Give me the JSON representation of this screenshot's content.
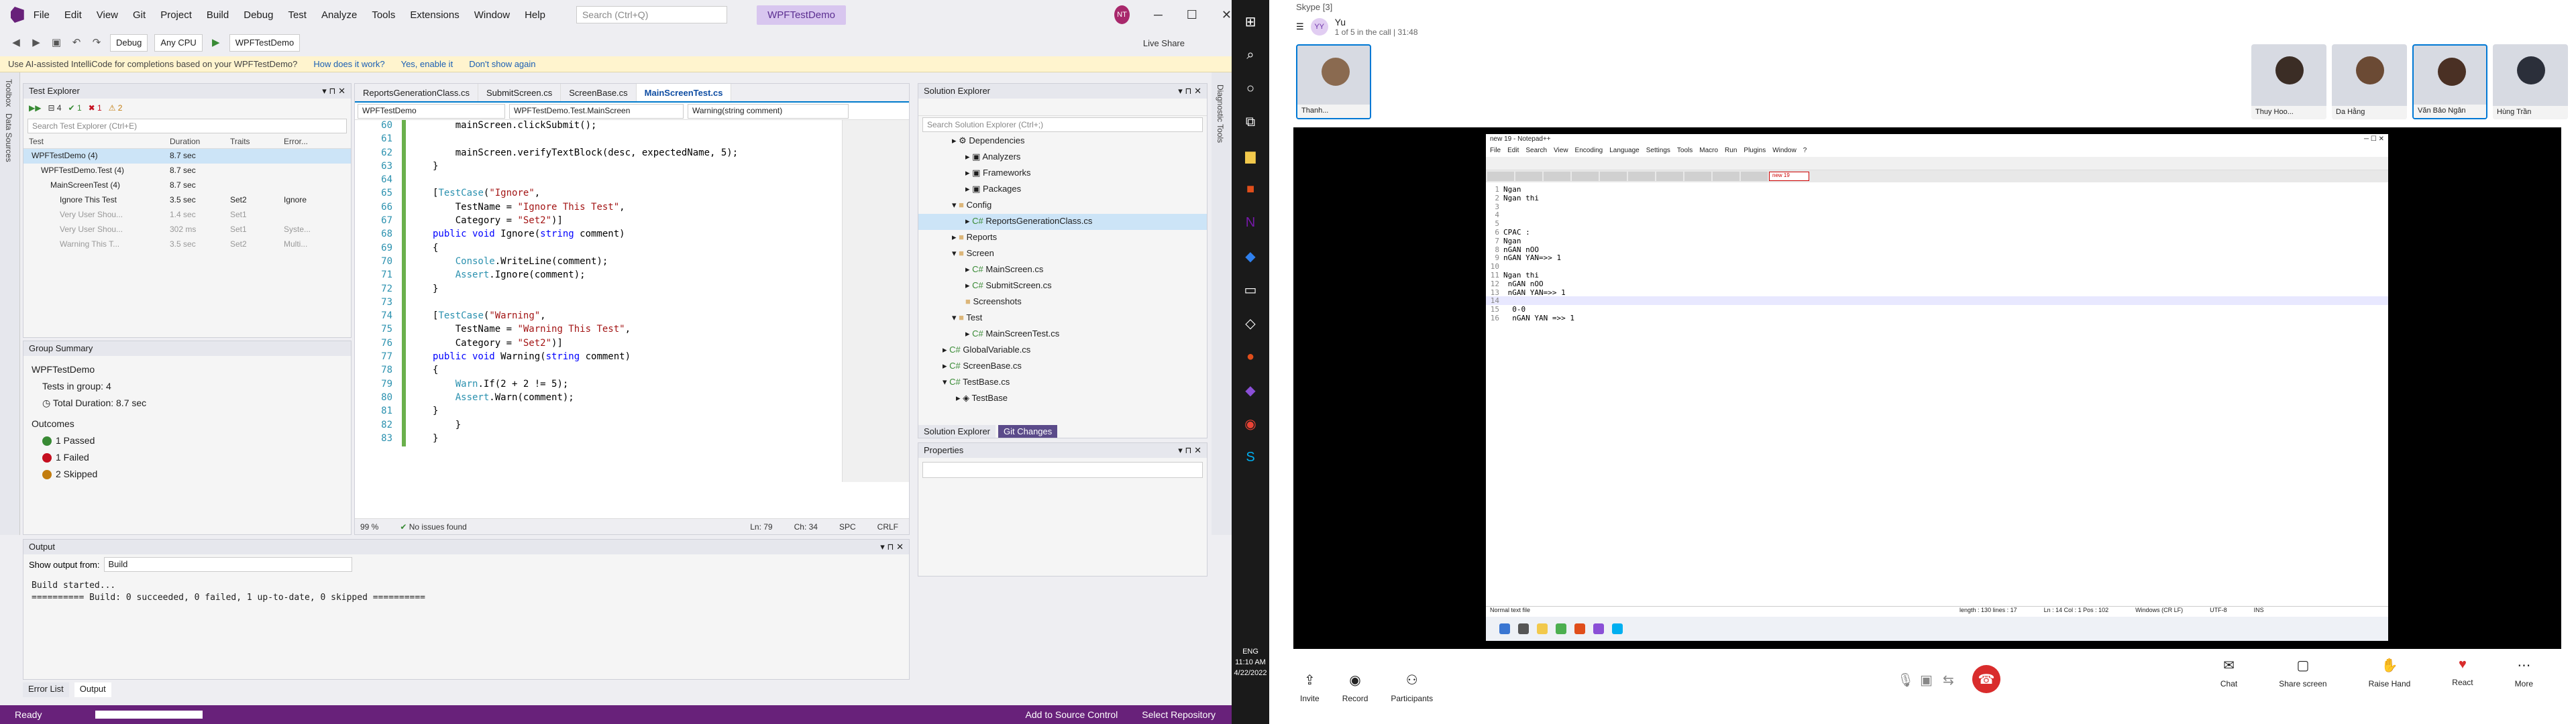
{
  "vs": {
    "menu": [
      "File",
      "Edit",
      "View",
      "Git",
      "Project",
      "Build",
      "Debug",
      "Test",
      "Analyze",
      "Tools",
      "Extensions",
      "Window",
      "Help"
    ],
    "search_placeholder": "Search (Ctrl+Q)",
    "solution_name": "WPFTestDemo",
    "avatar": "NT",
    "toolbar": {
      "config": "Debug",
      "platform": "Any CPU",
      "run": "WPFTestDemo",
      "live_share": "Live Share"
    },
    "info_bar": {
      "text": "Use AI-assisted IntelliCode for completions based on your WPFTestDemo?",
      "link1": "How does it work?",
      "link2": "Yes, enable it",
      "link3": "Don't show again"
    },
    "sidebar_left": [
      "Toolbox",
      "Data Sources"
    ],
    "sidebar_right": [
      "Diagnostic Tools"
    ],
    "test_explorer": {
      "title": "Test Explorer",
      "counts": {
        "total": "4",
        "passed": "1",
        "failed": "1",
        "skipped": "2"
      },
      "search": "Search Test Explorer (Ctrl+E)",
      "columns": [
        "Test",
        "Duration",
        "Traits",
        "Error..."
      ],
      "rows": [
        {
          "test": "WPFTestDemo (4)",
          "dur": "8.7 sec",
          "trait": "",
          "err": ""
        },
        {
          "test": "WPFTestDemo.Test (4)",
          "dur": "8.7 sec",
          "trait": "",
          "err": ""
        },
        {
          "test": "MainScreenTest (4)",
          "dur": "8.7 sec",
          "trait": "",
          "err": ""
        },
        {
          "test": "Ignore This Test",
          "dur": "3.5 sec",
          "trait": "Set2",
          "err": "Ignore"
        },
        {
          "test": "Very User Shou...",
          "dur": "1.4 sec",
          "trait": "Set1",
          "err": ""
        },
        {
          "test": "Very User Shou...",
          "dur": "302 ms",
          "trait": "Set1",
          "err": "Syste..."
        },
        {
          "test": "Warning This T...",
          "dur": "3.5 sec",
          "trait": "Set2",
          "err": "Multi..."
        }
      ]
    },
    "group_summary": {
      "title": "Group Summary",
      "name": "WPFTestDemo",
      "tests_in_group": "Tests in group: 4",
      "total_duration": "Total Duration: 8.7 sec",
      "outcomes": "Outcomes",
      "passed": "1 Passed",
      "failed": "1 Failed",
      "skipped": "2 Skipped"
    },
    "editor": {
      "tabs": [
        "ReportsGenerationClass.cs",
        "SubmitScreen.cs",
        "ScreenBase.cs",
        "MainScreenTest.cs"
      ],
      "nav": [
        "WPFTestDemo",
        "WPFTestDemo.Test.MainScreen",
        "Warning(string comment)"
      ],
      "status": {
        "zoom": "99 %",
        "issues": "No issues found",
        "ln": "Ln: 79",
        "ch": "Ch: 34",
        "spc": "SPC",
        "crlf": "CRLF"
      }
    },
    "solution_explorer": {
      "title": "Solution Explorer",
      "search": "Search Solution Explorer (Ctrl+;)",
      "items": [
        "Dependencies",
        "Analyzers",
        "Frameworks",
        "Packages",
        "Config",
        "ReportsGenerationClass.cs",
        "Reports",
        "Screen",
        "MainScreen.cs",
        "SubmitScreen.cs",
        "Screenshots",
        "Test",
        "MainScreenTest.cs",
        "GlobalVariable.cs",
        "ScreenBase.cs",
        "TestBase.cs",
        "TestBase"
      ],
      "tabs": [
        "Solution Explorer",
        "Git Changes"
      ]
    },
    "properties": {
      "title": "Properties"
    },
    "output": {
      "title": "Output",
      "show_from_label": "Show output from:",
      "show_from_value": "Build",
      "lines": [
        "Build started...",
        "========== Build: 0 succeeded, 0 failed, 1 up-to-date, 0 skipped =========="
      ]
    },
    "bottom_tabs": [
      "Error List",
      "Output"
    ],
    "status": {
      "ready": "Ready",
      "add_source": "Add to Source Control",
      "select_repo": "Select Repository"
    }
  },
  "taskbar": {
    "time": "11:10 AM",
    "date": "4/22/2022",
    "lang": "ENG"
  },
  "skype": {
    "title": "Skype [3]",
    "call_name": "Yu",
    "call_sub": "1 of 5 in the call | 31:48",
    "participants": [
      "Thanh...",
      "Thuy Hoo...",
      "Da Hằng",
      "Văn Bảo Ngân",
      "Hùng Trần"
    ],
    "notepad": {
      "title": "new 19 - Notepad++",
      "menu": [
        "File",
        "Edit",
        "Search",
        "View",
        "Encoding",
        "Language",
        "Settings",
        "Tools",
        "Macro",
        "Run",
        "Plugins",
        "Window",
        "?"
      ],
      "tab_active": "new 19",
      "lines": [
        "Ngan",
        "Ngan thi",
        "",
        "",
        "",
        "CPAC :",
        "Ngan",
        "nGAN nOO",
        "nGAN YAN=>> 1",
        "",
        "Ngan thi",
        " nGAN nOO",
        " nGAN YAN=>> 1",
        "",
        "  0-0",
        "  nGAN YAN =>> 1"
      ],
      "status": {
        "type": "Normal text file",
        "length": "length : 130   lines : 17",
        "pos": "Ln : 14   Col : 1   Pos : 102",
        "eol": "Windows (CR LF)",
        "enc": "UTF-8",
        "ins": "INS"
      }
    },
    "buttons": [
      "Invite",
      "Record",
      "Participants"
    ],
    "right_buttons": [
      "Chat",
      "Share screen",
      "Raise Hand",
      "React",
      "More"
    ]
  }
}
